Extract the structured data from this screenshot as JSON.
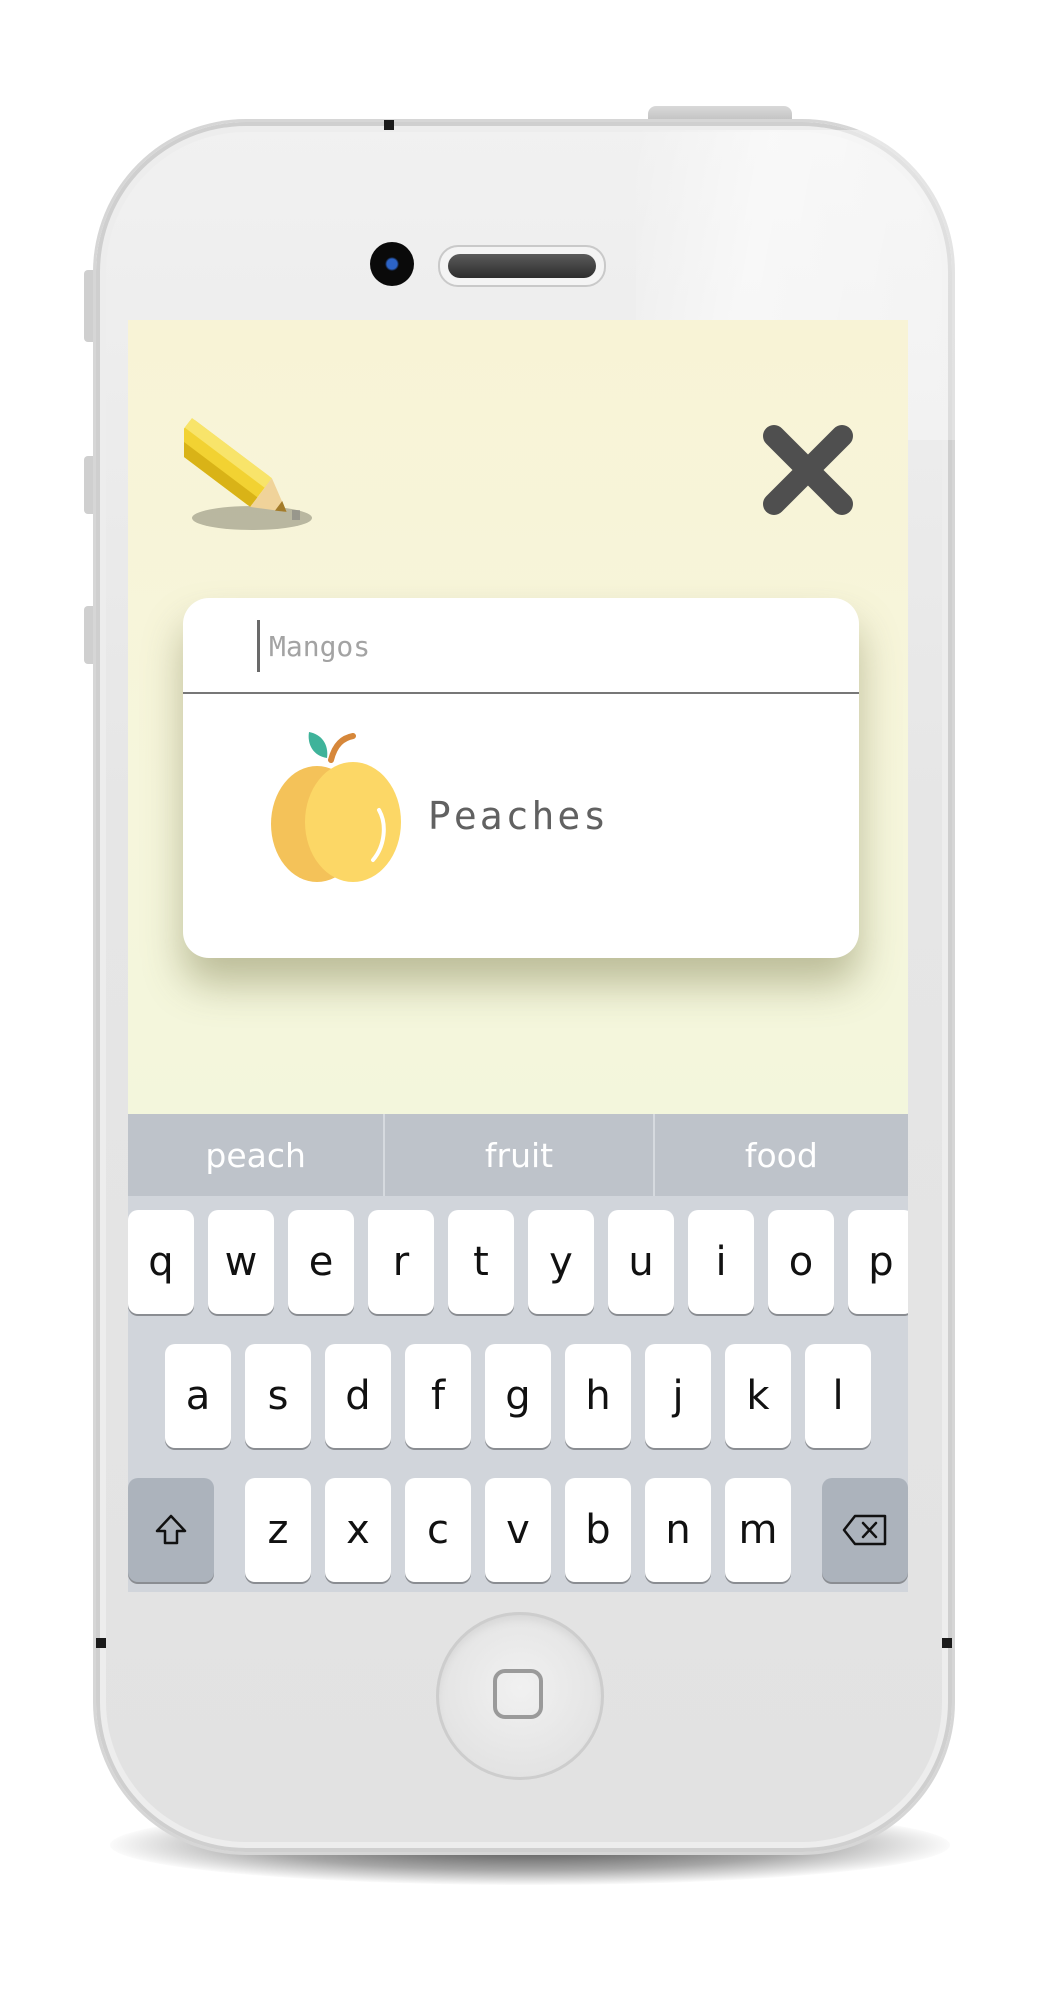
{
  "app": {
    "search": {
      "placeholder": "Mangos",
      "value": ""
    },
    "result": {
      "label": "Peaches",
      "icon": "peach-icon"
    },
    "edit_icon": "pencil-icon",
    "close_icon": "close-icon",
    "background_color": "#f7f5d9"
  },
  "keyboard": {
    "suggestions": [
      "peach",
      "fruit",
      "food"
    ],
    "row1": [
      "q",
      "w",
      "e",
      "r",
      "t",
      "y",
      "u",
      "i",
      "o",
      "p"
    ],
    "row2": [
      "a",
      "s",
      "d",
      "f",
      "g",
      "h",
      "j",
      "k",
      "l"
    ],
    "row3": [
      "z",
      "x",
      "c",
      "v",
      "b",
      "n",
      "m"
    ],
    "shift_icon": "shift-icon",
    "backspace_icon": "backspace-icon"
  },
  "device": {
    "home_button_icon": "home-button-icon"
  }
}
